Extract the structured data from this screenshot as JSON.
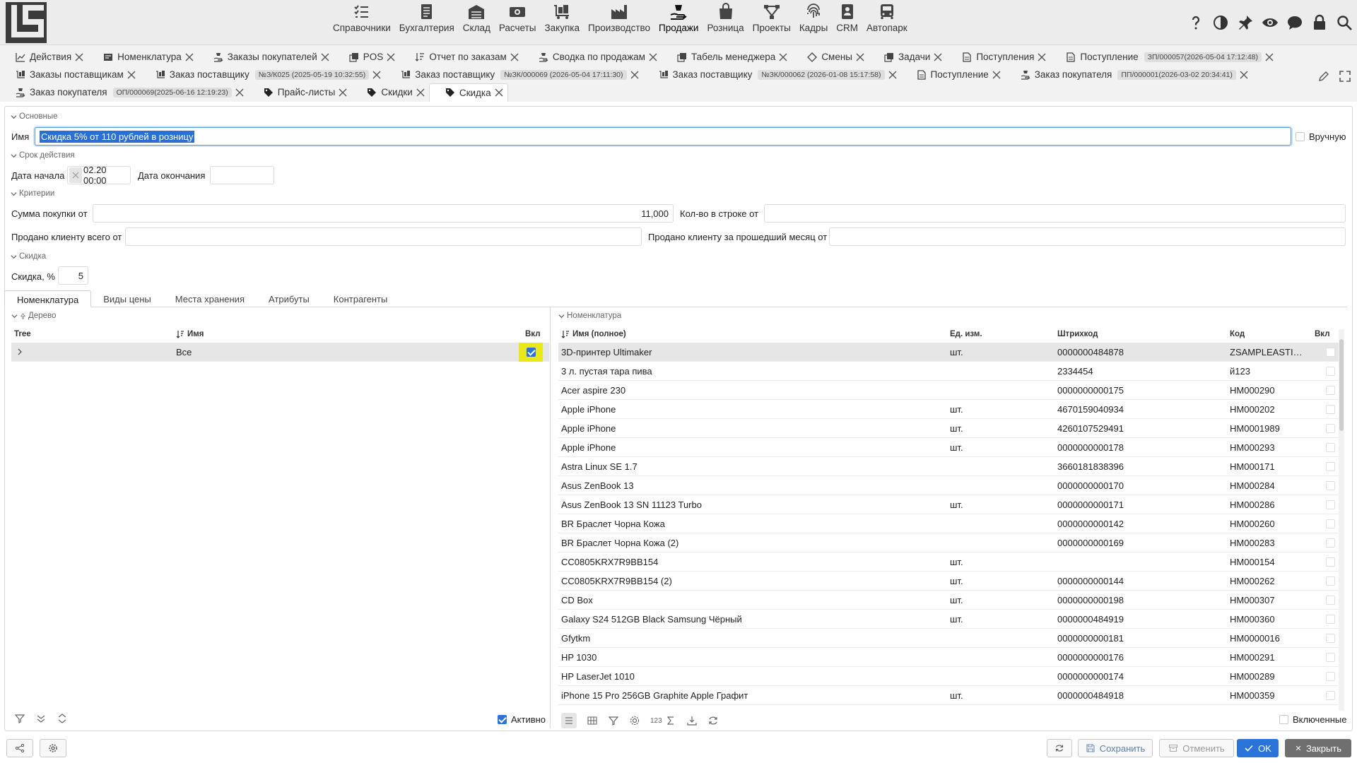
{
  "nav": {
    "items": [
      {
        "label": "Справочники",
        "icon": "checklist-icon"
      },
      {
        "label": "Бухгалтерия",
        "icon": "ledger-icon"
      },
      {
        "label": "Склад",
        "icon": "warehouse-icon"
      },
      {
        "label": "Расчеты",
        "icon": "money-icon"
      },
      {
        "label": "Закупка",
        "icon": "purchase-icon"
      },
      {
        "label": "Производство",
        "icon": "factory-icon"
      },
      {
        "label": "Продажи",
        "icon": "sales-hand-icon"
      },
      {
        "label": "Розница",
        "icon": "shopping-bag-icon"
      },
      {
        "label": "Проекты",
        "icon": "network-icon"
      },
      {
        "label": "Кадры",
        "icon": "fingerprint-icon"
      },
      {
        "label": "CRM",
        "icon": "badge-icon"
      },
      {
        "label": "Автопарк",
        "icon": "bus-icon"
      }
    ],
    "right_icons": [
      "help-icon",
      "contrast-icon",
      "pin-icon",
      "eye-icon",
      "chat-icon",
      "lock-icon",
      "search-icon"
    ]
  },
  "tabs": {
    "row1": [
      {
        "label": "Действия"
      },
      {
        "label": "Номенклатура"
      },
      {
        "label": "Заказы покупателей"
      },
      {
        "label": "POS"
      },
      {
        "label": "Отчет по заказам"
      },
      {
        "label": "Сводка по продажам"
      },
      {
        "label": "Табель менеджера"
      },
      {
        "label": "Смены"
      },
      {
        "label": "Задачи"
      },
      {
        "label": "Поступления"
      },
      {
        "label": "Поступление",
        "badge": "ЗП/000057(2026-05-04 17:12:48)"
      }
    ],
    "row2": [
      {
        "label": "Заказы поставщикам"
      },
      {
        "label": "Заказ поставщику",
        "badge": "№З/К025 (2025-05-19 10:32:55)"
      },
      {
        "label": "Заказ поставщику",
        "badge": "№ЗК/000069 (2026-05-04 17:11:30)"
      },
      {
        "label": "Заказ поставщику",
        "badge": "№ЗК/000062 (2026-01-08 15:17:58)"
      },
      {
        "label": "Поступление"
      },
      {
        "label": "Заказ покупателя",
        "badge": "ПП/000001(2026-03-02 20:34:41)"
      }
    ],
    "row3": [
      {
        "label": "Заказ покупателя",
        "badge": "ОП/000069(2025-06-16 12:19:23)"
      },
      {
        "label": "Прайс-листы"
      },
      {
        "label": "Скидки"
      },
      {
        "label": "Скидка"
      }
    ]
  },
  "form": {
    "section_main": "Основные",
    "name_label": "Имя",
    "name_value": "Скидка 5% от 110 рублей в розницу",
    "manual_label": "Вручную",
    "section_period": "Срок действия",
    "start_label": "Дата начала",
    "start_value": "02.20 00:00",
    "end_label": "Дата окончания",
    "end_value": "",
    "section_criteria": "Критерии",
    "sum_label": "Сумма покупки от",
    "sum_value": "11,000",
    "qty_label": "Кол-во в строке от",
    "qty_value": "",
    "sold_total_label": "Продано клиенту всего от",
    "sold_total_value": "",
    "sold_month_label": "Продано клиенту за прошедший месяц от",
    "sold_month_value": "",
    "section_discount": "Скидка",
    "discount_label": "Скидка, %",
    "discount_value": "5"
  },
  "inner_tabs": [
    "Номенклатура",
    "Виды цены",
    "Места хранения",
    "Атрибуты",
    "Контрагенты"
  ],
  "tree": {
    "section": "Дерево",
    "columns": [
      "Tree",
      "Имя",
      "Вкл"
    ],
    "rows": [
      {
        "name": "Все",
        "enabled": true
      }
    ],
    "active_label": "Активно"
  },
  "items": {
    "section": "Номенклатура",
    "columns": [
      "Имя (полное)",
      "Ед. изм.",
      "Штрихкод",
      "Код",
      "Вкл"
    ],
    "rows": [
      {
        "name": "3D-принтер Ultimaker",
        "unit": "шт.",
        "barcode": "0000000484878",
        "code": "ZSAMPLEASTITE..."
      },
      {
        "name": "3 л. пустая тара пива",
        "unit": "",
        "barcode": "2334454",
        "code": "й123"
      },
      {
        "name": "Acer aspire 230",
        "unit": "",
        "barcode": "0000000000175",
        "code": "НМ000290"
      },
      {
        "name": "Apple iPhone",
        "unit": "шт.",
        "barcode": "4670159040934",
        "code": "НМ000202"
      },
      {
        "name": "Apple iPhone",
        "unit": "шт.",
        "barcode": "4260107529491",
        "code": "НМ0001989"
      },
      {
        "name": "Apple iPhone",
        "unit": "шт.",
        "barcode": "0000000000178",
        "code": "НМ000293"
      },
      {
        "name": "Astra Linux SE 1.7",
        "unit": "",
        "barcode": "3660181838396",
        "code": "НМ000171"
      },
      {
        "name": "Asus ZenBook 13",
        "unit": "",
        "barcode": "0000000000170",
        "code": "НМ000284"
      },
      {
        "name": "Asus ZenBook 13 SN 11123 Turbo",
        "unit": "шт.",
        "barcode": "0000000000171",
        "code": "НМ000286"
      },
      {
        "name": "BR Браслет Чорна Кожа",
        "unit": "",
        "barcode": "0000000000142",
        "code": "НМ000260"
      },
      {
        "name": "BR Браслет Чорна Кожа (2)",
        "unit": "",
        "barcode": "0000000000169",
        "code": "НМ000283"
      },
      {
        "name": "CC0805KRX7R9BB154",
        "unit": "шт.",
        "barcode": "",
        "code": "НМ000154"
      },
      {
        "name": "CC0805KRX7R9BB154 (2)",
        "unit": "шт.",
        "barcode": "0000000000144",
        "code": "НМ000262"
      },
      {
        "name": "CD Box",
        "unit": "шт.",
        "barcode": "0000000000198",
        "code": "НМ000307"
      },
      {
        "name": "Galaxy S24 512GB Black Samsung Чёрный",
        "unit": "шт.",
        "barcode": "0000000484919",
        "code": "НМ000360"
      },
      {
        "name": "Gfytkm",
        "unit": "",
        "barcode": "0000000000181",
        "code": "НМ0000016"
      },
      {
        "name": "HP 1030",
        "unit": "",
        "barcode": "0000000000176",
        "code": "НМ000291"
      },
      {
        "name": "HP LaserJet 1010",
        "unit": "",
        "barcode": "0000000000174",
        "code": "НМ000289"
      },
      {
        "name": "iPhone 15 Pro 256GB Graphite Apple Графит",
        "unit": "шт.",
        "barcode": "0000000484918",
        "code": "НМ000359"
      }
    ],
    "footer_count": "123",
    "included_label": "Включенные"
  },
  "bottom": {
    "save_label": "Сохранить",
    "cancel_label": "Отменить",
    "ok_label": "OK",
    "close_label": "Закрыть"
  },
  "colors": {
    "accent": "#2a73d8",
    "tree_highlight": "#e8e81c",
    "close_button": "#6f6f6f"
  }
}
